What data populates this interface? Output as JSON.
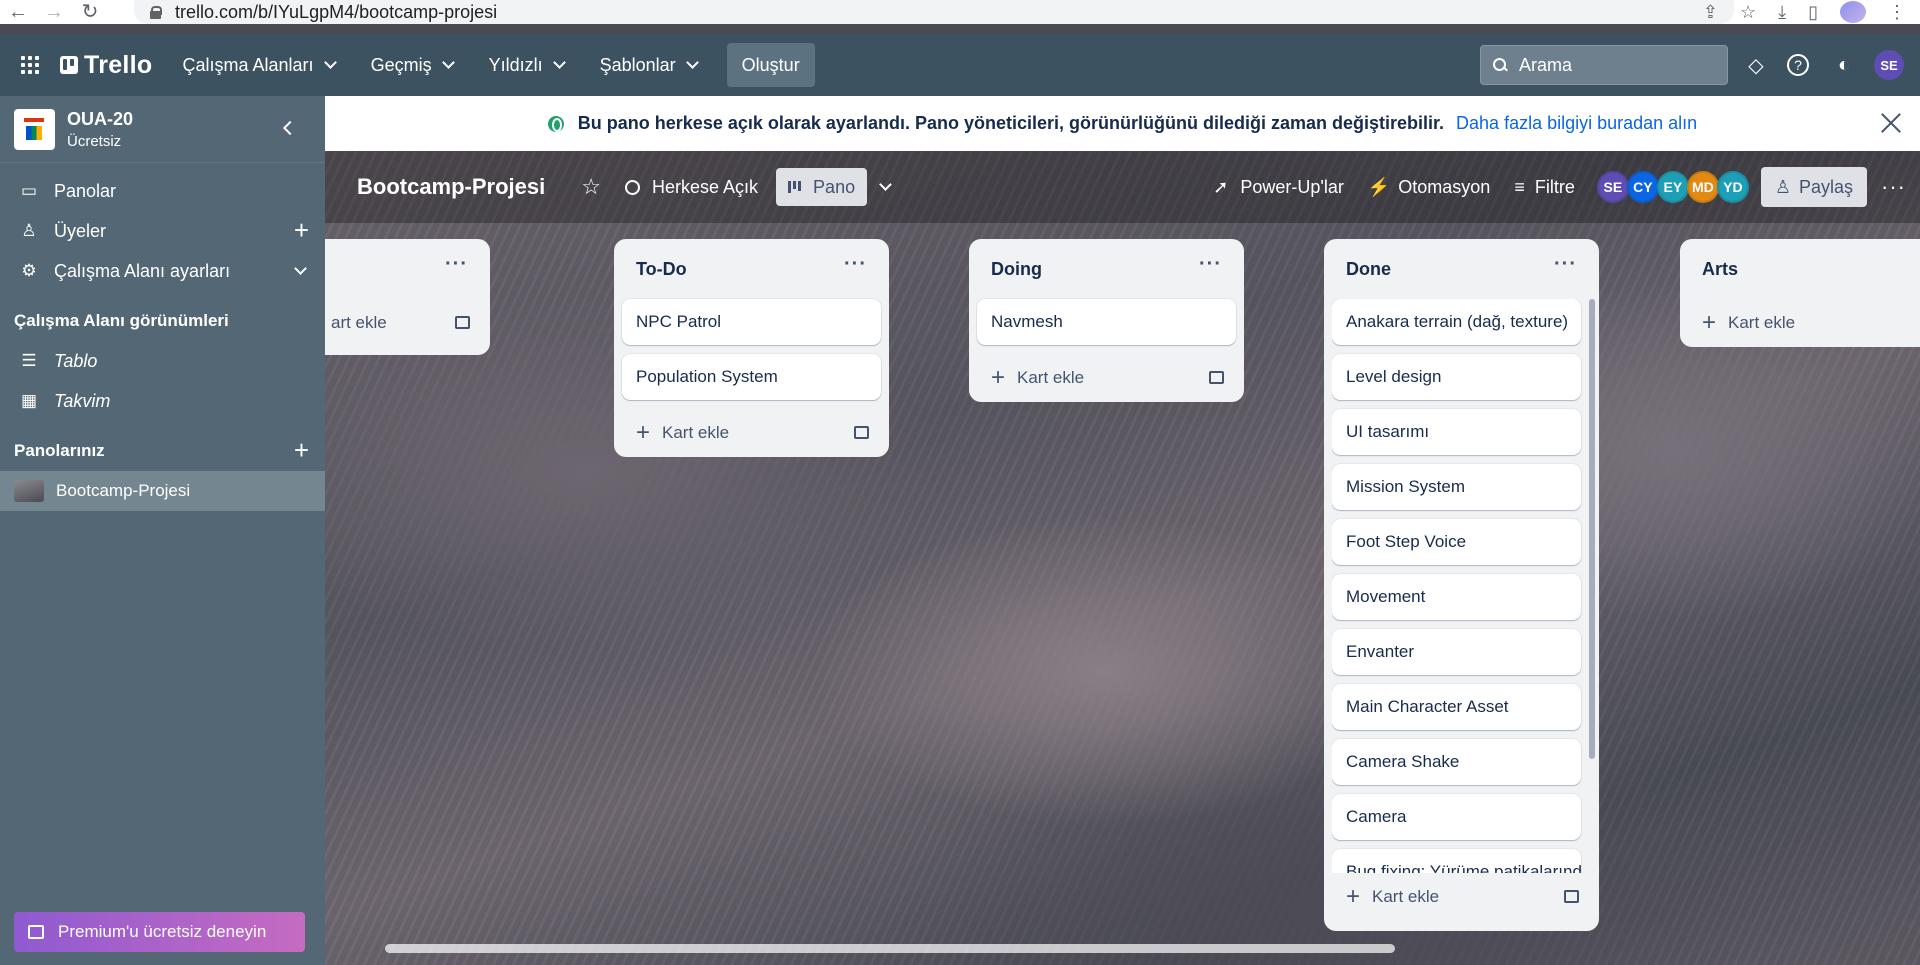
{
  "browser": {
    "url": "trello.com/b/IYuLgpM4/bootcamp-projesi"
  },
  "header": {
    "logo": "Trello",
    "menus": [
      "Çalışma Alanları",
      "Geçmiş",
      "Yıldızlı",
      "Şablonlar"
    ],
    "create_label": "Oluştur",
    "search_placeholder": "Arama",
    "user_initials": "SE"
  },
  "banner": {
    "message": "Bu pano herkese açık olarak ayarlandı. Pano yöneticileri, görünürlüğünü dilediği zaman değiştirebilir.",
    "link": "Daha fazla bilgiyi buradan alın"
  },
  "sidebar": {
    "workspace_name": "OUA-20",
    "workspace_plan": "Ücretsiz",
    "items": [
      {
        "label": "Panolar",
        "icon": "board-icon"
      },
      {
        "label": "Üyeler",
        "icon": "person-icon"
      },
      {
        "label": "Çalışma Alanı ayarları",
        "icon": "gear-icon"
      }
    ],
    "views_title": "Çalışma Alanı görünümleri",
    "views": [
      {
        "label": "Tablo",
        "icon": "table-icon"
      },
      {
        "label": "Takvim",
        "icon": "calendar-icon"
      }
    ],
    "boards_title": "Panolarınız",
    "boards": [
      "Bootcamp-Projesi"
    ],
    "premium_label": "Premium'u ücretsiz deneyin"
  },
  "board": {
    "title": "Bootcamp-Projesi",
    "visibility": "Herkese Açık",
    "view": "Pano",
    "powerups": "Power-Up'lar",
    "automation": "Otomasyon",
    "filter": "Filtre",
    "members": [
      {
        "initials": "SE",
        "color": "#5e4db2"
      },
      {
        "initials": "CY",
        "color": "#0c66e4"
      },
      {
        "initials": "EY",
        "color": "#1d9fb5"
      },
      {
        "initials": "MD",
        "color": "#e28a12"
      },
      {
        "initials": "YD",
        "color": "#1d9fb5"
      }
    ],
    "share": "Paylaş",
    "add_card": "Kart ekle",
    "add_card_partial": "art ekle",
    "lists": [
      {
        "title": "To-Do",
        "cards": [
          "NPC Patrol",
          "Population System"
        ]
      },
      {
        "title": "Doing",
        "cards": [
          "Navmesh"
        ]
      },
      {
        "title": "Done",
        "cards": [
          "Anakara terrain (dağ, texture)",
          "Level design",
          "UI tasarımı",
          "Mission System",
          "Foot Step Voice",
          "Movement",
          "Envanter",
          "Main Character Asset",
          "Camera Shake",
          "Camera",
          "Bug fixing: Yürüme patikalarındaki"
        ]
      },
      {
        "title": "Arts",
        "cards": []
      }
    ]
  }
}
